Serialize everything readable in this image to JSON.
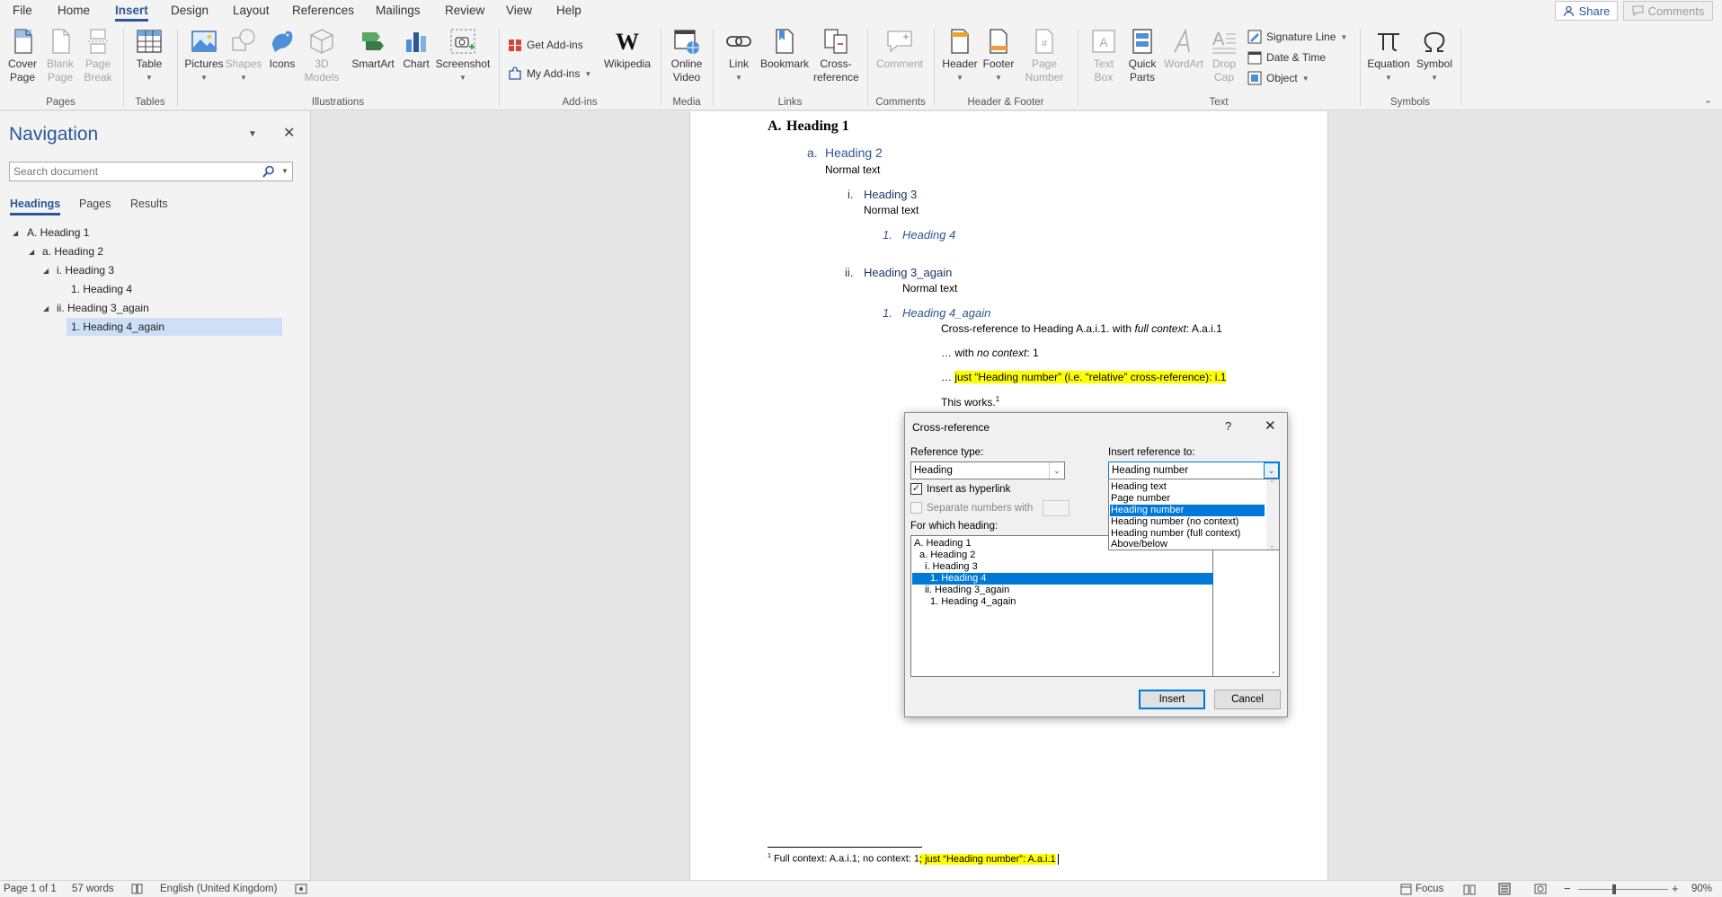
{
  "menu": {
    "tabs": [
      "File",
      "Home",
      "Insert",
      "Design",
      "Layout",
      "References",
      "Mailings",
      "Review",
      "View",
      "Help"
    ],
    "active_tab": "Insert",
    "share_label": "Share",
    "comments_label": "Comments"
  },
  "ribbon": {
    "pages": {
      "label": "Pages",
      "cover": "Cover Page",
      "blank": "Blank Page",
      "break": "Page Break"
    },
    "tables": {
      "label": "Tables",
      "table": "Table"
    },
    "illustrations": {
      "label": "Illustrations",
      "pictures": "Pictures",
      "shapes": "Shapes",
      "icons": "Icons",
      "models": "3D Models",
      "smartart": "SmartArt",
      "chart": "Chart",
      "screenshot": "Screenshot"
    },
    "addins": {
      "label": "Add-ins",
      "get": "Get Add-ins",
      "my": "My Add-ins",
      "wikipedia": "Wikipedia"
    },
    "media": {
      "label": "Media",
      "video": "Online Video"
    },
    "links": {
      "label": "Links",
      "link": "Link",
      "bookmark": "Bookmark",
      "crossref": "Cross-reference"
    },
    "comments": {
      "label": "Comments",
      "comment": "Comment"
    },
    "headerfooter": {
      "label": "Header & Footer",
      "header": "Header",
      "footer": "Footer",
      "pagenum": "Page Number"
    },
    "text": {
      "label": "Text",
      "textbox": "Text Box",
      "quickparts": "Quick Parts",
      "wordart": "WordArt",
      "dropcap": "Drop Cap",
      "signature": "Signature Line",
      "datetime": "Date & Time",
      "object": "Object"
    },
    "symbols": {
      "label": "Symbols",
      "equation": "Equation",
      "symbol": "Symbol"
    }
  },
  "navigation": {
    "title": "Navigation",
    "search_placeholder": "Search document",
    "tabs": [
      "Headings",
      "Pages",
      "Results"
    ],
    "items": [
      "A. Heading 1",
      "a. Heading 2",
      "i. Heading 3",
      "1. Heading 4",
      "ii. Heading 3_again",
      "1. Heading 4_again"
    ]
  },
  "document": {
    "h1_num": "A.",
    "h1": "Heading 1",
    "h2_num": "a.",
    "h2": "Heading 2",
    "normal1": "Normal text",
    "h3_num": "i.",
    "h3": "Heading 3",
    "normal2": "Normal text",
    "h4_num": "1.",
    "h4": "Heading 4",
    "h3b_num": "ii.",
    "h3b": "Heading 3_again",
    "normal3": "Normal text",
    "h4b_num": "1.",
    "h4b": "Heading 4_again",
    "line1_a": "Cross-reference to Heading A.a.i.1. with ",
    "line1_b": "full context",
    "line1_c": ": A.a.i.1",
    "line2_a": "… with ",
    "line2_b": "no context",
    "line2_c": ": 1",
    "line3_a": "… ",
    "line3_b": "just “Heading number” (i.e. “relative” cross-reference): i.1",
    "line4": "This works.",
    "line4_sup": "1",
    "footnote_sup": "1",
    "footnote_a": " Full context: A.a.i.1; no context: 1",
    "footnote_b": "; just “Heading number”: A.a.i.1"
  },
  "dialog": {
    "title": "Cross-reference",
    "help": "?",
    "ref_type_label": "Reference type:",
    "ref_type_value": "Heading",
    "insert_ref_label": "Insert reference to:",
    "insert_ref_value": "Heading number",
    "hyperlink_label": "Insert as hyperlink",
    "separate_label": "Separate numbers with",
    "which_label": "For which heading:",
    "dropdown_options": [
      "Heading text",
      "Page number",
      "Heading number",
      "Heading number (no context)",
      "Heading number (full  context)",
      "Above/below"
    ],
    "headings": [
      "A. Heading 1",
      "a. Heading 2",
      "i. Heading 3",
      "1. Heading 4",
      "ii. Heading 3_again",
      "1. Heading 4_again"
    ],
    "insert_btn": "Insert",
    "cancel_btn": "Cancel"
  },
  "status": {
    "page": "Page 1 of 1",
    "words": "57 words",
    "language": "English (United Kingdom)",
    "focus": "Focus",
    "zoom": "90%",
    "zoom_fraction": 0.4
  },
  "colors": {
    "accent": "#2b579a",
    "selection": "#0078d7",
    "highlight": "#ffff00"
  }
}
